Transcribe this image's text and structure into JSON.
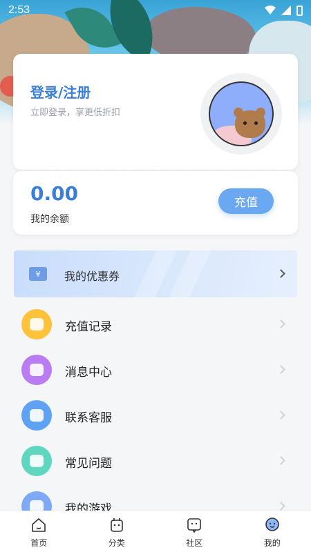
{
  "status_bar": {
    "time": "2:53"
  },
  "login_card": {
    "title": "登录/注册",
    "subtitle": "立即登录，享更低折扣"
  },
  "balance_card": {
    "amount": "0.00",
    "label": "我的余额",
    "recharge_button": "充值"
  },
  "coupon": {
    "label": "我的优惠券",
    "icon_text": "¥"
  },
  "menu": [
    {
      "label": "充值记录",
      "icon": "money-bag-icon",
      "color": "#ffc23a"
    },
    {
      "label": "消息中心",
      "icon": "message-icon",
      "color": "#b97cf2"
    },
    {
      "label": "联系客服",
      "icon": "headset-icon",
      "color": "#5ea1f5"
    },
    {
      "label": "常见问题",
      "icon": "question-icon",
      "color": "#5fd6c0"
    },
    {
      "label": "我的游戏",
      "icon": "gamepad-icon",
      "color": "#7eaaf5"
    }
  ],
  "tabbar": [
    {
      "label": "首页",
      "icon": "home-icon"
    },
    {
      "label": "分类",
      "icon": "category-icon"
    },
    {
      "label": "社区",
      "icon": "community-icon"
    },
    {
      "label": "我的",
      "icon": "profile-icon",
      "active": true
    }
  ],
  "colors": {
    "accent": "#3b7ed6",
    "button": "#6aa8f2"
  }
}
